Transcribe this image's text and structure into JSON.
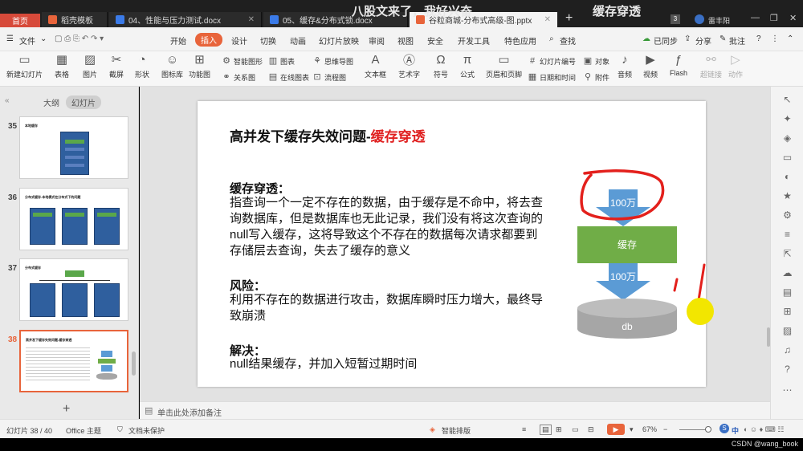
{
  "tabs": {
    "home": "首页",
    "t1": "稻壳模板",
    "t2": "04、性能与压力测试.docx",
    "t3": "05、缓存&分布式锁.docx",
    "t4": "谷粒商城-分布式高级-图.pptx",
    "add": "+",
    "badge": "3",
    "user": "雷丰阳"
  },
  "watermark": {
    "w1": "八股文来了，我好兴奋",
    "w2": "缓存穿透"
  },
  "menu": {
    "file": "文件",
    "start": "开始",
    "insert": "插入",
    "design": "设计",
    "switch": "切换",
    "anim": "动画",
    "show": "幻灯片放映",
    "review": "审阅",
    "view": "视图",
    "security": "安全",
    "dev": "开发工具",
    "special": "特色应用",
    "find": "查找",
    "sync": "已同步",
    "share": "分享",
    "annotate": "批注"
  },
  "ribbon": {
    "new_slide": "新建幻灯片",
    "table": "表格",
    "image": "图片",
    "screenshot": "截屏",
    "shape": "形状",
    "iconlib": "图标库",
    "func": "功能图",
    "smart": "智能图形",
    "chart": "图表",
    "mindmap": "思维导图",
    "relation": "关系图",
    "online_chart": "在线图表",
    "flow": "流程图",
    "textbox": "文本框",
    "art": "艺术字",
    "symbol": "符号",
    "formula": "公式",
    "header": "页眉和页脚",
    "slide_no": "幻灯片编号",
    "object": "对象",
    "datetime": "日期和时间",
    "attach": "附件",
    "audio": "音频",
    "video": "视频",
    "flash": "Flash",
    "hyperlink": "超链接",
    "action": "动作"
  },
  "panel": {
    "outline": "大纲",
    "slides": "幻灯片",
    "add": "+",
    "items": [
      {
        "num": "35",
        "title": "本地缓存"
      },
      {
        "num": "36",
        "title": "分布式缓存-本地模式在分布式下的问题"
      },
      {
        "num": "37",
        "title": "分布式缓存"
      },
      {
        "num": "38",
        "title": "高并发下缓存失效问题-缓存穿透"
      }
    ]
  },
  "slide": {
    "title_black": "高并发下缓存失效问题-",
    "title_red": "缓存穿透",
    "h1": "缓存穿透：",
    "p1": "指查询一个一定不存在的数据，由于缓存是不命中，将去查询数据库，但是数据库也无此记录，我们没有将这次查询的null写入缓存，这将导致这个不存在的数据每次请求都要到存储层去查询，失去了缓存的意义",
    "h2": "风险：",
    "p2": "利用不存在的数据进行攻击，数据库瞬时压力增大，最终导致崩溃",
    "h3": "解决：",
    "p3": "null结果缓存，并加入短暂过期时间",
    "diagram": {
      "arrow1": "100万",
      "cache": "缓存",
      "arrow2": "100万",
      "db": "db"
    },
    "colors": {
      "arrow": "#5b9bd5",
      "cache": "#70ad47",
      "db": "#a6a6a6",
      "annot": "#e3201c",
      "cursor": "#f2e600"
    }
  },
  "notes": {
    "placeholder": "单击此处添加备注"
  },
  "status": {
    "slide_pos": "幻灯片 38 / 40",
    "theme": "Office 主题",
    "protect": "文档未保护",
    "smart_layout": "智能排版",
    "zoom": "67%",
    "csdn": "CSDN @wang_book",
    "ime": "中"
  }
}
